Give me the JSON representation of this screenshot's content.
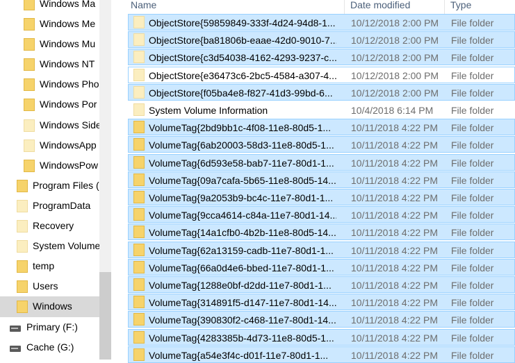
{
  "nav": {
    "items": [
      {
        "label": "Windows Ma",
        "level": 3,
        "pale": false,
        "selected": false
      },
      {
        "label": "Windows Me",
        "level": 3,
        "pale": false,
        "selected": false
      },
      {
        "label": "Windows Mu",
        "level": 3,
        "pale": false,
        "selected": false
      },
      {
        "label": "Windows NT",
        "level": 3,
        "pale": false,
        "selected": false
      },
      {
        "label": "Windows Pho",
        "level": 3,
        "pale": false,
        "selected": false
      },
      {
        "label": "Windows Por",
        "level": 3,
        "pale": false,
        "selected": false
      },
      {
        "label": "Windows Side",
        "level": 3,
        "pale": true,
        "selected": false
      },
      {
        "label": "WindowsApp",
        "level": 3,
        "pale": true,
        "selected": false
      },
      {
        "label": "WindowsPow",
        "level": 3,
        "pale": false,
        "selected": false
      },
      {
        "label": "Program Files (",
        "level": 2,
        "pale": false,
        "selected": false
      },
      {
        "label": "ProgramData",
        "level": 2,
        "pale": true,
        "selected": false
      },
      {
        "label": "Recovery",
        "level": 2,
        "pale": true,
        "selected": false
      },
      {
        "label": "System Volume",
        "level": 2,
        "pale": true,
        "selected": false
      },
      {
        "label": "temp",
        "level": 2,
        "pale": false,
        "selected": false
      },
      {
        "label": "Users",
        "level": 2,
        "pale": false,
        "selected": false
      },
      {
        "label": "Windows",
        "level": 2,
        "pale": false,
        "selected": true
      },
      {
        "label": "Primary (F:)",
        "level": 1,
        "drive": true,
        "selected": false
      },
      {
        "label": "Cache (G:)",
        "level": 1,
        "drive": true,
        "selected": false
      }
    ],
    "chevron": "^"
  },
  "columns": {
    "name": "Name",
    "date": "Date modified",
    "type": "Type"
  },
  "files": [
    {
      "name": "ObjectStore{59859849-333f-4d24-94d8-1...",
      "date": "10/12/2018 2:00 PM",
      "type": "File folder",
      "state": "sel",
      "pale": true
    },
    {
      "name": "ObjectStore{ba81806b-eaae-42d0-9010-7...",
      "date": "10/12/2018 2:00 PM",
      "type": "File folder",
      "state": "sel",
      "pale": true
    },
    {
      "name": "ObjectStore{c3d54038-4162-4293-9237-c...",
      "date": "10/12/2018 2:00 PM",
      "type": "File folder",
      "state": "sel",
      "pale": true
    },
    {
      "name": "ObjectStore{e36473c6-2bc5-4584-a307-4...",
      "date": "10/12/2018 2:00 PM",
      "type": "File folder",
      "state": "focus",
      "pale": true
    },
    {
      "name": "ObjectStore{f05ba4e8-f827-41d3-99bd-6...",
      "date": "10/12/2018 2:00 PM",
      "type": "File folder",
      "state": "sel",
      "pale": true
    },
    {
      "name": "System Volume Information",
      "date": "10/4/2018 6:14 PM",
      "type": "File folder",
      "state": "plain",
      "pale": true
    },
    {
      "name": "VolumeTag{2bd9bb1c-4f08-11e8-80d5-1...",
      "date": "10/11/2018 4:22 PM",
      "type": "File folder",
      "state": "sel",
      "pale": false
    },
    {
      "name": "VolumeTag{6ab20003-58d3-11e8-80d5-1...",
      "date": "10/11/2018 4:22 PM",
      "type": "File folder",
      "state": "sel",
      "pale": false
    },
    {
      "name": "VolumeTag{6d593e58-bab7-11e7-80d1-1...",
      "date": "10/11/2018 4:22 PM",
      "type": "File folder",
      "state": "sel",
      "pale": false
    },
    {
      "name": "VolumeTag{09a7cafa-5b65-11e8-80d5-14...",
      "date": "10/11/2018 4:22 PM",
      "type": "File folder",
      "state": "sel",
      "pale": false
    },
    {
      "name": "VolumeTag{9a2053b9-bc4c-11e7-80d1-1...",
      "date": "10/11/2018 4:22 PM",
      "type": "File folder",
      "state": "sel",
      "pale": false
    },
    {
      "name": "VolumeTag{9cca4614-c84a-11e7-80d1-14...",
      "date": "10/11/2018 4:22 PM",
      "type": "File folder",
      "state": "sel",
      "pale": false
    },
    {
      "name": "VolumeTag{14a1cfb0-4b2b-11e8-80d5-14...",
      "date": "10/11/2018 4:22 PM",
      "type": "File folder",
      "state": "sel",
      "pale": false
    },
    {
      "name": "VolumeTag{62a13159-cadb-11e7-80d1-1...",
      "date": "10/11/2018 4:22 PM",
      "type": "File folder",
      "state": "sel",
      "pale": false
    },
    {
      "name": "VolumeTag{66a0d4e6-bbed-11e7-80d1-1...",
      "date": "10/11/2018 4:22 PM",
      "type": "File folder",
      "state": "sel",
      "pale": false
    },
    {
      "name": "VolumeTag{1288e0bf-d2dd-11e7-80d1-1...",
      "date": "10/11/2018 4:22 PM",
      "type": "File folder",
      "state": "sel",
      "pale": false
    },
    {
      "name": "VolumeTag{314891f5-d147-11e7-80d1-14...",
      "date": "10/11/2018 4:22 PM",
      "type": "File folder",
      "state": "sel",
      "pale": false
    },
    {
      "name": "VolumeTag{390830f2-c468-11e7-80d1-14...",
      "date": "10/11/2018 4:22 PM",
      "type": "File folder",
      "state": "sel",
      "pale": false
    },
    {
      "name": "VolumeTag{4283385b-4d73-11e8-80d5-1...",
      "date": "10/11/2018 4:22 PM",
      "type": "File folder",
      "state": "sel",
      "pale": false
    },
    {
      "name": "VolumeTag{a54e3f4c-d01f-11e7-80d1-1...",
      "date": "10/11/2018 4:22 PM",
      "type": "File folder",
      "state": "sel",
      "pale": false
    }
  ],
  "colors": {
    "selection": "#cce8ff",
    "selection_border": "#99d1ff",
    "folder": "#f6d36b",
    "nav_selected": "#d9d9d9"
  }
}
